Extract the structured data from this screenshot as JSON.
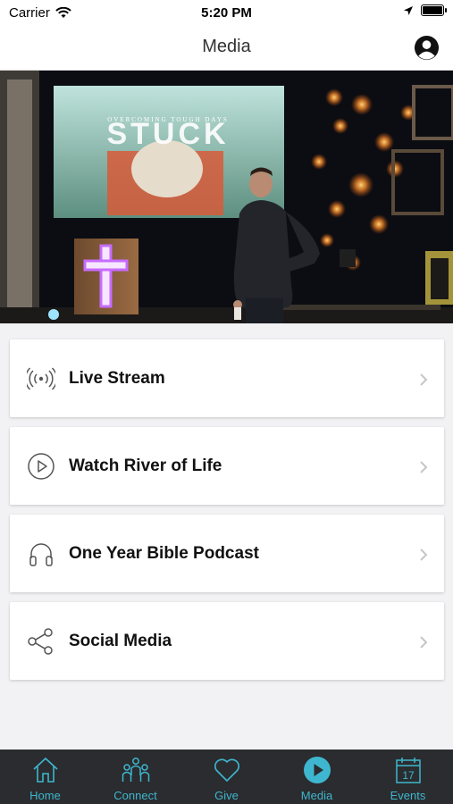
{
  "status": {
    "carrier": "Carrier",
    "time": "5:20 PM"
  },
  "header": {
    "title": "Media"
  },
  "hero": {
    "screen_title": "STUCK",
    "screen_subtitle": "OVERCOMING TOUGH DAYS"
  },
  "menu": {
    "items": [
      {
        "label": "Live Stream",
        "icon": "broadcast-icon"
      },
      {
        "label": "Watch River of Life",
        "icon": "play-circle-icon"
      },
      {
        "label": "One Year Bible Podcast",
        "icon": "headphones-icon"
      },
      {
        "label": "Social Media",
        "icon": "share-icon"
      }
    ]
  },
  "tabs": {
    "items": [
      {
        "label": "Home",
        "icon": "home-icon"
      },
      {
        "label": "Connect",
        "icon": "people-icon"
      },
      {
        "label": "Give",
        "icon": "heart-icon"
      },
      {
        "label": "Media",
        "icon": "play-icon",
        "active": true
      },
      {
        "label": "Events",
        "icon": "calendar-icon",
        "day": "17"
      }
    ]
  },
  "colors": {
    "accent": "#3fb6cf",
    "tabbar": "#2a2c2f",
    "background": "#f2f2f4"
  }
}
